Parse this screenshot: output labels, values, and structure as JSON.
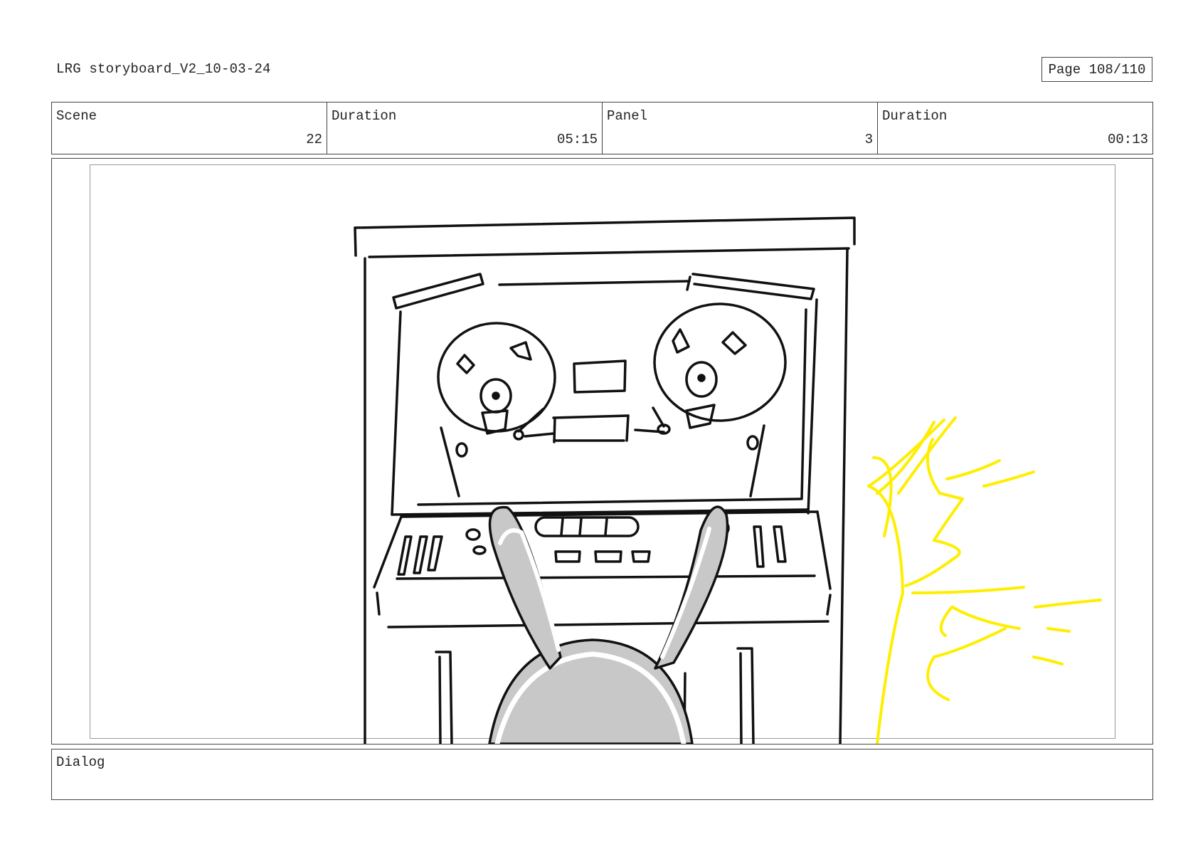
{
  "header": {
    "doc_title": "LRG storyboard_V2_10-03-24",
    "page_label": "Page 108/110"
  },
  "info": {
    "scene_label": "Scene",
    "scene_value": "22",
    "scene_duration_label": "Duration",
    "scene_duration_value": "05:15",
    "panel_label": "Panel",
    "panel_value": "3",
    "panel_duration_label": "Duration",
    "panel_duration_value": "00:13"
  },
  "dialog": {
    "label": "Dialog",
    "text": ""
  },
  "colors": {
    "ink": "#111111",
    "bunny_fill": "#c8c8c8",
    "flash": "#ffee00"
  }
}
